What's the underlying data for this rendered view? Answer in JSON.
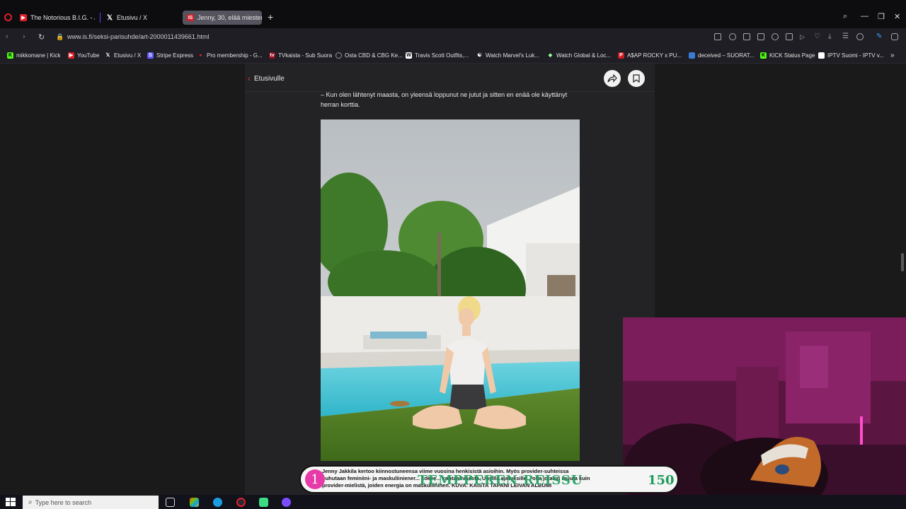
{
  "browser": {
    "tabs": [
      {
        "label": "The Notorious B.I.G. - Juic",
        "favicon": "youtube-icon",
        "active": false
      },
      {
        "label": "Etusivu / X",
        "favicon": "x-icon",
        "active": false
      },
      {
        "label": "Jenny, 30, elää miesten ra",
        "favicon": "is-icon",
        "active": true
      }
    ],
    "url": "www.is.fi/seksi-parisuhde/art-2000011439661.html",
    "bookmarks": [
      {
        "label": "mikkomane | Kick",
        "icon": "kick-icon"
      },
      {
        "label": "YouTube",
        "icon": "youtube-icon"
      },
      {
        "label": "Etusivu / X",
        "icon": "x-icon"
      },
      {
        "label": "Stripe Express",
        "icon": "stripe-icon"
      },
      {
        "label": "Pro membership - G...",
        "icon": "pin-icon"
      },
      {
        "label": "TVkaista - Sub Suora",
        "icon": "tv-icon"
      },
      {
        "label": "Osta CBD & CBG Ke...",
        "icon": "globe-icon"
      },
      {
        "label": "Travis Scott Outfits,...",
        "icon": "w-icon"
      },
      {
        "label": "Watch Marvel's Luk...",
        "icon": "swirl-icon"
      },
      {
        "label": "Watch Global & Loc...",
        "icon": "gamepad-icon"
      },
      {
        "label": "A$AP ROCKY x PU...",
        "icon": "puma-icon"
      },
      {
        "label": "deceived – SUORAT...",
        "icon": "image-icon"
      },
      {
        "label": "KICK Status Page",
        "icon": "kick-icon"
      },
      {
        "label": "IPTV Suomi - IPTV v...",
        "icon": "grid-icon"
      }
    ]
  },
  "article": {
    "back_label": "Etusivulle",
    "quote": "– Kun olen lähtenyt maasta, on yleensä loppunut ne jutut ja sitten en enää ole käyttänyt herran korttia."
  },
  "overlay": {
    "number": "1",
    "caption": "Jenny Jakkila kertoo kiinnostuneensa viime vuosina henkisistä asioihin. Myös provider-suhteissa puhutaan feminiini- ja maskuliiniener... kokee... kohtaamisesta. Uusilla ajatuksille... olla jotakin muuta kuin provider-mielistä, joiden energia on maskuliininen. KUVA: KAISTA TAPANI LEIVAN ALBUMI",
    "title": "TEMPPEREN REISSU",
    "count": "150"
  },
  "taskbar": {
    "search_placeholder": "Type here to search"
  }
}
